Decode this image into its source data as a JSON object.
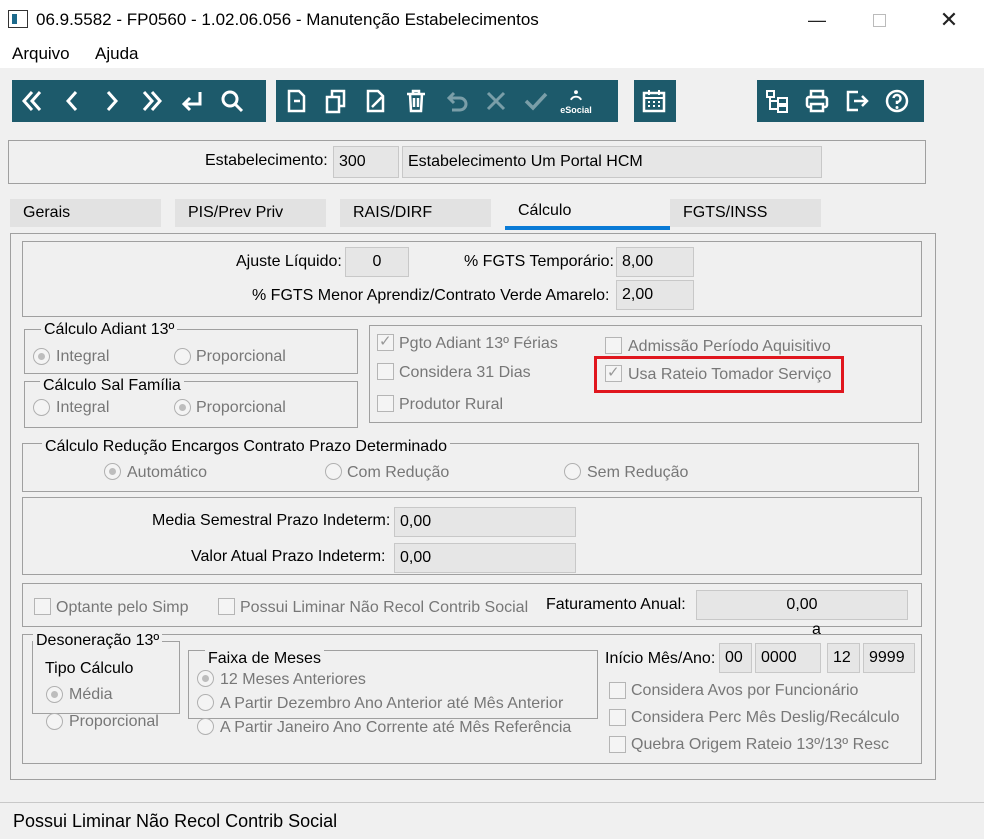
{
  "window": {
    "title": "06.9.5582 - FP0560 - 1.02.06.056 - Manutenção Estabelecimentos"
  },
  "menu": {
    "items": [
      "Arquivo",
      "Ajuda"
    ]
  },
  "toolbar": {
    "navigation": [
      "first-icon",
      "previous-icon",
      "next-icon",
      "last-icon",
      "goto-icon",
      "search-icon"
    ],
    "edit": [
      "new-icon",
      "copy-icon",
      "edit-icon",
      "delete-icon",
      "undo-icon",
      "cancel-icon",
      "save-icon",
      "esocial-icon"
    ],
    "esocial_label": "eSocial",
    "extra": [
      "calendar-icon"
    ],
    "right": [
      "tree-icon",
      "print-icon",
      "exit-icon",
      "help-icon"
    ]
  },
  "header": {
    "label": "Estabelecimento:",
    "code": "300",
    "name": "Estabelecimento Um Portal HCM"
  },
  "tabs": [
    "Gerais",
    "PIS/Prev Priv",
    "RAIS/DIRF",
    "Cálculo",
    "FGTS/INSS"
  ],
  "calc": {
    "ajuste_label": "Ajuste Líquido:",
    "ajuste_value": "0",
    "fgts_temp_label": "% FGTS Temporário:",
    "fgts_temp_value": "8,00",
    "fgts_menor_label": "% FGTS Menor Aprendiz/Contrato Verde Amarelo:",
    "fgts_menor_value": "2,00",
    "adiant13": {
      "title": "Cálculo Adiant 13º",
      "opt1": "Integral",
      "opt2": "Proporcional"
    },
    "salfamilia": {
      "title": "Cálculo Sal Família",
      "opt1": "Integral",
      "opt2": "Proporcional"
    },
    "checks": {
      "pgto": "Pgto Adiant 13º Férias",
      "considera31": "Considera 31 Dias",
      "produtor": "Produtor Rural",
      "admissao": "Admissão Período Aquisitivo",
      "rateio": "Usa Rateio Tomador Serviço"
    },
    "reducao": {
      "title": "Cálculo Redução Encargos Contrato Prazo Determinado",
      "opt1": "Automático",
      "opt2": "Com Redução",
      "opt3": "Sem Redução"
    },
    "media_label": "Media Semestral Prazo Indeterm:",
    "media_value": "0,00",
    "valor_label": "Valor Atual Prazo Indeterm:",
    "valor_value": "0,00",
    "optante": "Optante pelo Simp",
    "liminar": "Possui Liminar Não Recol Contrib Social",
    "faturamento_label": "Faturamento Anual:",
    "faturamento_value": "0,00",
    "desoneracao": {
      "title": "Desoneração 13º",
      "tipo": "Tipo Cálculo",
      "media": "Média",
      "proporcional": "Proporcional",
      "faixa": "Faixa de Meses",
      "f1": "12 Meses Anteriores",
      "f2": "A Partir Dezembro Ano Anterior até Mês Anterior",
      "f3": "A Partir Janeiro Ano Corrente até Mês Referência"
    },
    "inicio_label": "Início Mês/Ano:",
    "a_label": "a",
    "inicio_mes": "00",
    "inicio_ano": "0000",
    "fim_mes": "12",
    "fim_ano": "9999",
    "avos": "Considera Avos por Funcionário",
    "perc": "Considera Perc Mês Deslig/Recálculo",
    "quebra": "Quebra Origem Rateio 13º/13º Resc"
  },
  "status": {
    "text": "Possui Liminar Não Recol Contrib Social"
  }
}
